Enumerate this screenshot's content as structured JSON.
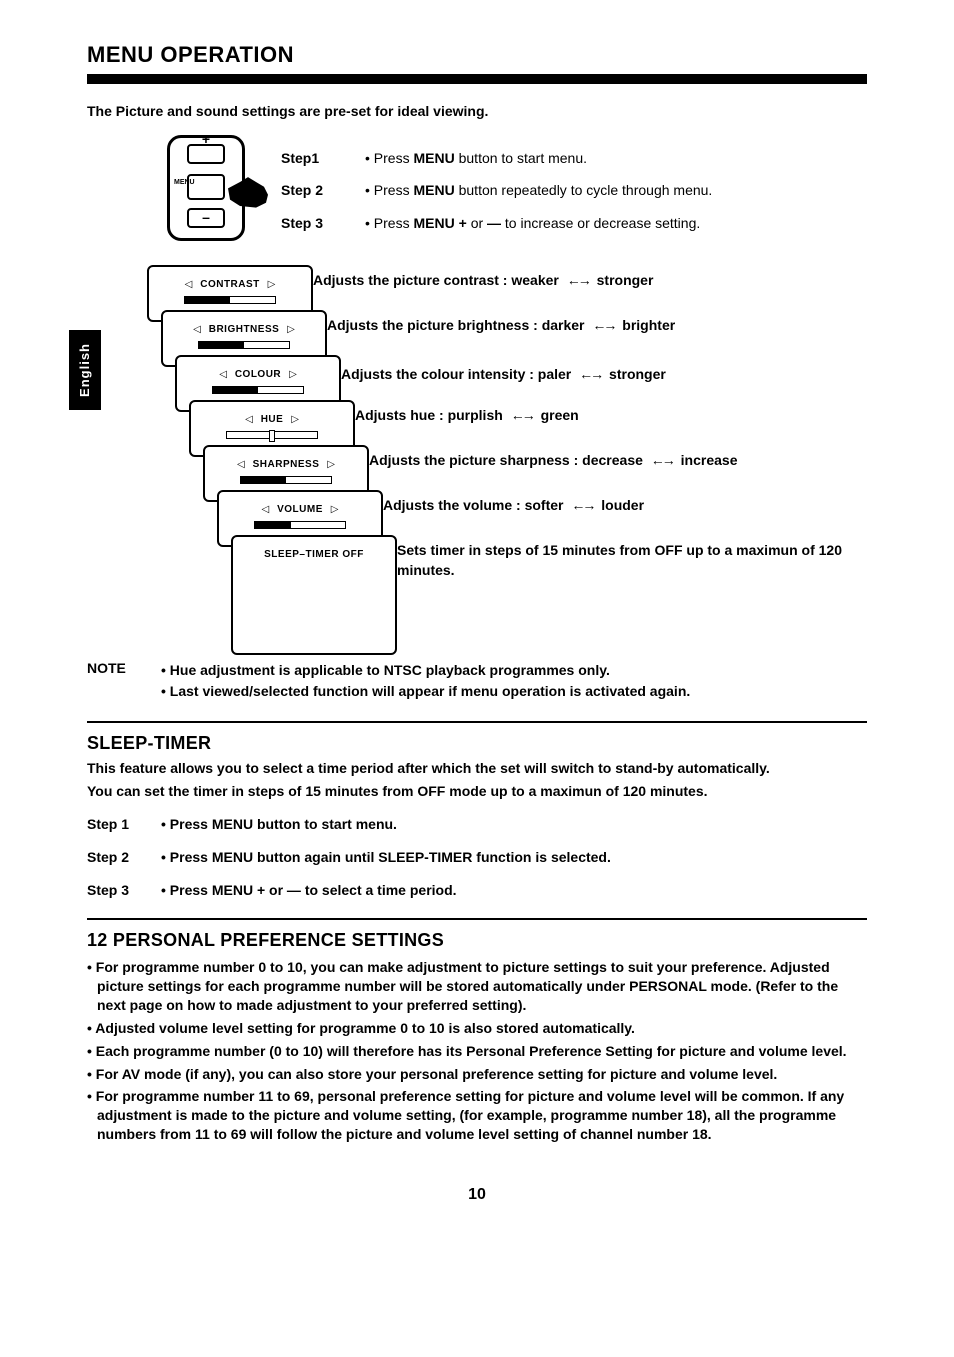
{
  "title": "MENU OPERATION",
  "side_tab": "English",
  "intro": "The Picture and sound settings are pre-set for ideal viewing.",
  "remote": {
    "menu_label": "MENU"
  },
  "steps": [
    {
      "label": "Step1",
      "bullet": "•",
      "pre": "Press ",
      "b1": "MENU",
      "post": " button to start menu."
    },
    {
      "label": "Step 2",
      "bullet": "•",
      "pre": "Press ",
      "b1": "MENU",
      "post": " button repeatedly to cycle through menu."
    },
    {
      "label": "Step 3",
      "bullet": "•",
      "pre": "Press ",
      "b1": "MENU",
      "mid1": "  +  ",
      "or": "or",
      "mid2": "  —  ",
      "post": "to increase or decrease setting."
    }
  ],
  "osd": [
    {
      "name": "CONTRAST",
      "desc_pre": "Adjusts the picture contrast : ",
      "left": "weaker",
      "right": "stronger"
    },
    {
      "name": "BRIGHTNESS",
      "desc_pre": "Adjusts the picture brightness : ",
      "left": "darker",
      "right": "brighter"
    },
    {
      "name": "COLOUR",
      "desc_pre": "Adjusts the colour intensity : ",
      "left": "paler",
      "right": "stronger"
    },
    {
      "name": "HUE",
      "desc_pre": "Adjusts hue : ",
      "left": "purplish",
      "right": "green"
    },
    {
      "name": "SHARPNESS",
      "desc_pre": "Adjusts the picture sharpness : ",
      "left": "decrease",
      "right": "increase"
    },
    {
      "name": "VOLUME",
      "desc_pre": "Adjusts the volume : ",
      "left": "softer",
      "right": "louder"
    },
    {
      "name": "SLEEP–TIMER  OFF",
      "desc_full": "Sets timer in steps of 15 minutes from OFF up to a maximun of 120 minutes."
    }
  ],
  "note": {
    "label": "NOTE",
    "items": [
      "Hue adjustment is applicable to NTSC playback programmes only.",
      "Last viewed/selected function will appear if menu operation is activated again."
    ]
  },
  "sleep": {
    "heading": "SLEEP-TIMER",
    "p1": "This feature allows you to select a time period after which the set will switch to stand-by automatically.",
    "p2": "You can set the timer in steps of 15 minutes from OFF mode up to a maximun of 120 minutes.",
    "steps": [
      {
        "label": "Step 1",
        "pre": "• Press ",
        "b1": "MENU",
        "post": " button to start menu."
      },
      {
        "label": "Step 2",
        "pre": "• Press ",
        "b1": "MENU",
        "mid": " button again until ",
        "b2": "SLEEP-TIMER",
        "post": " function is selected."
      },
      {
        "label": "Step 3",
        "pre": "• Press ",
        "b1": "MENU",
        "mid1": " + ",
        "or": " or ",
        "mid2": " — ",
        "post": " to  select a time period."
      }
    ]
  },
  "pref": {
    "heading": "12 PERSONAL PREFERENCE SETTINGS",
    "items": [
      "For programme number 0 to 10, you can make adjustment to picture settings to suit your preference. Adjusted picture settings for each programme number will be stored automatically under PERSONAL mode. (Refer to the next page on how to made adjustment to your preferred setting).",
      "Adjusted volume level setting for programme 0 to 10 is also stored automatically.",
      "Each programme number (0 to 10) will therefore has its Personal Preference Setting for picture and volume level.",
      "For AV mode (if any), you can also store your personal preference setting for picture and volume level.",
      "For programme number 11 to 69, personal preference setting for picture and volume level will be common. If any adjustment is made to the picture and volume setting, (for example, programme number 18), all the programme numbers from 11 to 69 will follow the picture and volume level setting of channel number 18."
    ]
  },
  "page_number": "10"
}
